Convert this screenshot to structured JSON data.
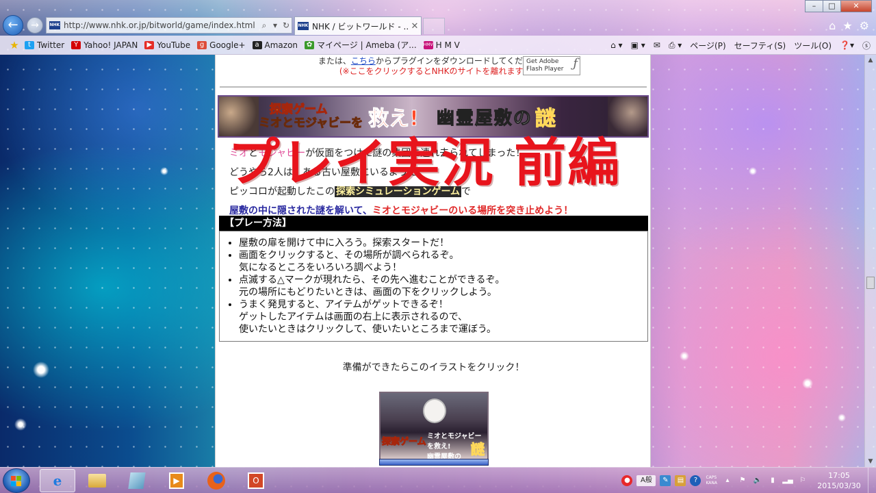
{
  "browser": {
    "address_url": "http://www.nhk.or.jp/bitworld/game/index.html",
    "tab_title": "NHK / ビットワールド - ...",
    "site_icon_text": "NHK",
    "window_controls": [
      "–",
      "□",
      "✕"
    ],
    "right_icons": [
      "home-icon",
      "star-icon",
      "gear-icon"
    ]
  },
  "favorites": {
    "items": [
      {
        "label": "Twitter",
        "icon": "twitter-icon",
        "color": "#1da1f2"
      },
      {
        "label": "Yahoo! JAPAN",
        "icon": "yahoo-icon",
        "color": "#d40000"
      },
      {
        "label": "YouTube",
        "icon": "youtube-icon",
        "color": "#e52d27"
      },
      {
        "label": "Google+",
        "icon": "googleplus-icon",
        "color": "#dd4b39"
      },
      {
        "label": "Amazon",
        "icon": "amazon-icon",
        "color": "#222222"
      },
      {
        "label": "マイページ | Ameba (ア...",
        "icon": "ameba-icon",
        "color": "#3a9a2a"
      },
      {
        "label": "H M V",
        "icon": "hmv-icon",
        "color": "#c8147a"
      }
    ],
    "commands": {
      "page": "ページ(P)",
      "safety": "セーフティ(S)",
      "tools": "ツール(O)"
    }
  },
  "page": {
    "plugin_prefix": "または、",
    "plugin_link": "こちら",
    "plugin_suffix": "からプラグインをダウンロードしてください。",
    "plugin_note": "(※ここをクリックするとNHKのサイトを離れます)",
    "flash_badge_line1": "Get Adobe",
    "flash_badge_line2": "Flash Player",
    "banner": {
      "line1": "探索ゲーム",
      "line2": "ミオとモジャビーを",
      "save": "救え!",
      "mansion": "幽霊屋敷の",
      "mystery": "謎"
    },
    "story": {
      "l1_name1": "ミオ",
      "l1_name2": "モジャビー",
      "l1_text": "が仮面をつけた謎の集団に連れ去られてしまった！",
      "l2": "どうやら2人は、ある古い屋敷にいるようだ。",
      "l3_pre": "ピッコロが起動したこの",
      "l3_hl": "探索シミュレーションゲーム",
      "l3_post": "で",
      "l4_a": "屋敷の中に隠された謎を解いて、",
      "l4_b": "ミオとモジャビーのいる場所を突き止めよう！"
    },
    "howto_title": "【プレー方法】",
    "howto_items": [
      "屋敷の扉を開けて中に入ろう。探索スタートだ！",
      "画面をクリックすると、その場所が調べられるぞ。",
      "気になるところをいろいろ調べよう！",
      "点滅する△マークが現れたら、その先へ進むことができるぞ。",
      "元の場所にもどりたいときは、画面の下をクリックしよう。",
      "うまく発見すると、アイテムがゲットできるぞ！",
      "ゲットしたアイテムは画面の右上に表示されるので、",
      "使いたいときはクリックして、使いたいところまで運ぼう。"
    ],
    "ready_text": "準備ができたらこのイラストをクリック！",
    "illust": {
      "t1": "探索ゲーム",
      "t2": "ミオとモジャビーを救え!",
      "t2b": "幽霊屋敷の",
      "t3": "謎"
    }
  },
  "overlay": {
    "title": "プレイ実況 前編"
  },
  "taskbar": {
    "items": [
      "ie-icon",
      "folder-icon",
      "notepad-icon",
      "media-player-icon",
      "firefox-icon",
      "office-icon"
    ],
    "ime": "A般",
    "caps": "CAPS",
    "kana": "KANA",
    "time": "17:05",
    "date": "2015/03/30"
  }
}
